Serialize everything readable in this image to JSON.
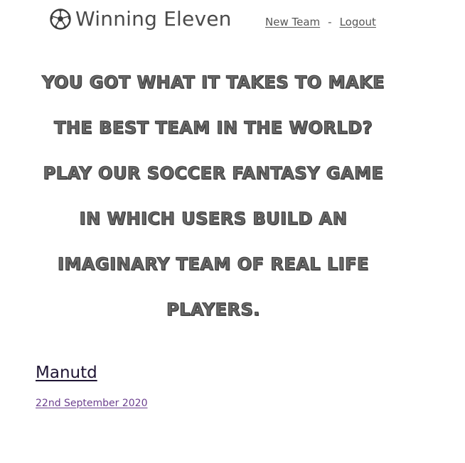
{
  "nav": {
    "brand_icon": "soccer-ball-icon",
    "brand_name": "Winning Eleven",
    "links": [
      {
        "label": "New Team"
      },
      {
        "label": "Logout"
      }
    ],
    "separator": "-"
  },
  "hero": {
    "lines": [
      "You got what it takes to make",
      "the best team in the world?",
      "Play our soccer fantasy game",
      "in which users build an",
      "imaginary team of real life",
      "players."
    ]
  },
  "posts": [
    {
      "title": "Manutd",
      "date": "22nd September 2020"
    }
  ],
  "colors": {
    "text": "#4a4a4a",
    "hero_fill": "#6e6e6e",
    "hero_outline": "#404040",
    "post_title": "#1e1433",
    "post_date": "#6b3f8e",
    "background": "#ffffff"
  }
}
